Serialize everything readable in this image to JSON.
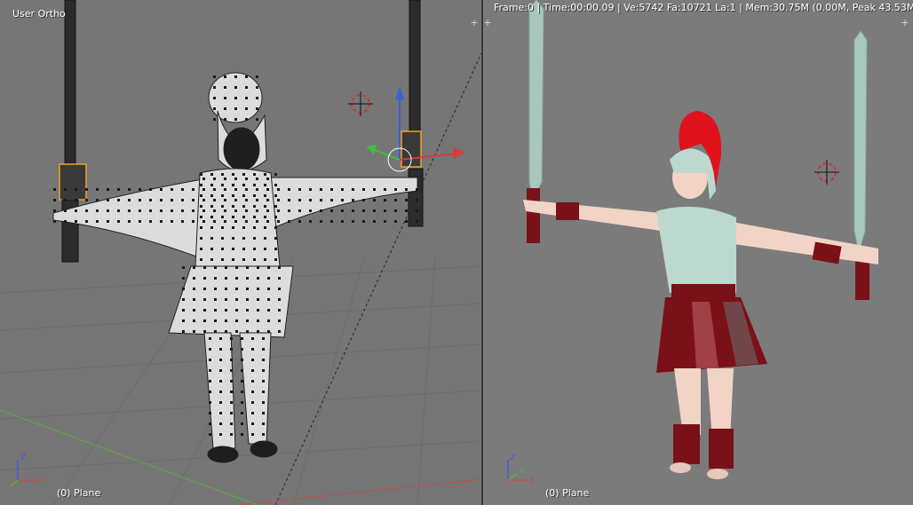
{
  "left_viewport": {
    "view_label": "User Ortho",
    "object_label": "(0) Plane",
    "shading": "wireframe-edit-mode"
  },
  "right_viewport": {
    "stats": "Frame:0 | Time:00:00.09 | Ve:5742 Fa:10721 La:1 | Mem:30.75M (0.00M, Peak 43.53M)",
    "object_label": "(0) Plane",
    "shading": "solid"
  },
  "axes_gizmo": {
    "x": "X",
    "y": "Y",
    "z": "Z"
  },
  "colors": {
    "viewport_bg": "#767676",
    "grid": "#6b6b6b",
    "x_axis": "#c84a4a",
    "y_axis": "#5fae3c",
    "z_axis": "#3b5fd8",
    "armor": "#bcd8cf",
    "cloth_red": "#7a1118",
    "plume_red": "#e0121b",
    "skin": "#f2d4c6",
    "select_orange": "#f0a020"
  },
  "icons": [
    "3d-cursor-icon",
    "transform-manipulator-icon",
    "viewport-corner-icon",
    "axes-gizmo-icon"
  ]
}
